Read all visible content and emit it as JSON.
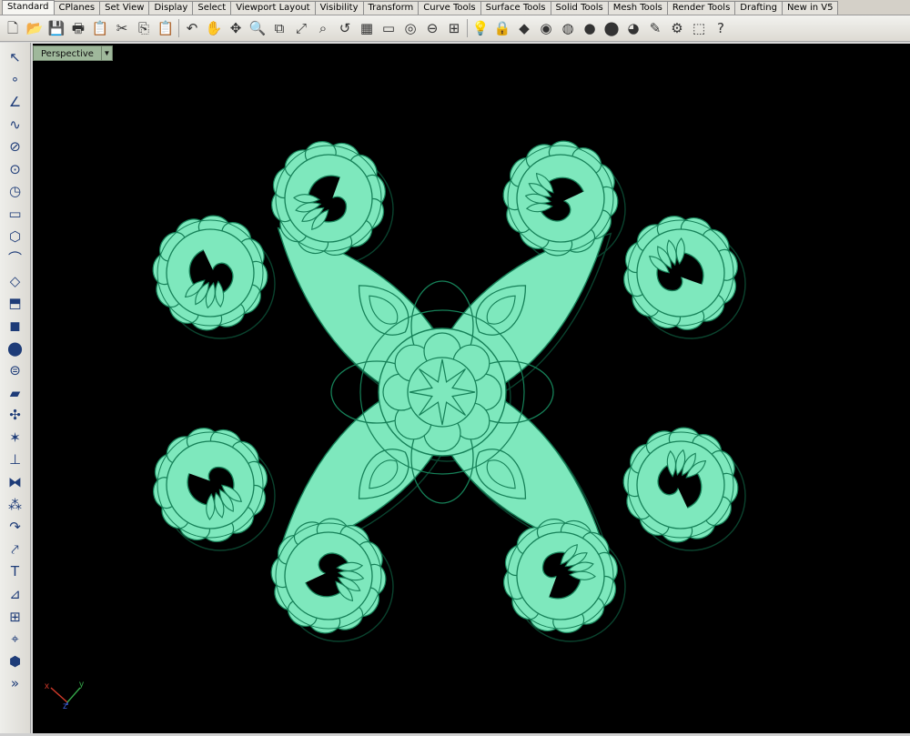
{
  "tabs": [
    {
      "label": "Standard",
      "active": true
    },
    {
      "label": "CPlanes"
    },
    {
      "label": "Set View"
    },
    {
      "label": "Display"
    },
    {
      "label": "Select"
    },
    {
      "label": "Viewport Layout"
    },
    {
      "label": "Visibility"
    },
    {
      "label": "Transform"
    },
    {
      "label": "Curve Tools"
    },
    {
      "label": "Surface Tools"
    },
    {
      "label": "Solid Tools"
    },
    {
      "label": "Mesh Tools"
    },
    {
      "label": "Render Tools"
    },
    {
      "label": "Drafting"
    },
    {
      "label": "New in V5"
    }
  ],
  "toolbar": [
    {
      "name": "new-icon",
      "glyph": "🗋"
    },
    {
      "name": "open-icon",
      "glyph": "📂"
    },
    {
      "name": "save-icon",
      "glyph": "💾"
    },
    {
      "name": "print-icon",
      "glyph": "🖶"
    },
    {
      "name": "import-icon",
      "glyph": "📋"
    },
    {
      "name": "cut-icon",
      "glyph": "✂"
    },
    {
      "name": "copy-icon",
      "glyph": "⎘"
    },
    {
      "name": "paste-icon",
      "glyph": "📋"
    },
    {
      "name": "undo-icon",
      "glyph": "↶"
    },
    {
      "name": "pan-hand-icon",
      "glyph": "✋"
    },
    {
      "name": "rotate-view-icon",
      "glyph": "✥"
    },
    {
      "name": "zoom-dynamic-icon",
      "glyph": "🔍"
    },
    {
      "name": "zoom-window-icon",
      "glyph": "⧉"
    },
    {
      "name": "zoom-extents-icon",
      "glyph": "⤢"
    },
    {
      "name": "zoom-selected-icon",
      "glyph": "⌕"
    },
    {
      "name": "undo-view-icon",
      "glyph": "↺"
    },
    {
      "name": "four-viewports-icon",
      "glyph": "▦"
    },
    {
      "name": "cplane-icon",
      "glyph": "▭"
    },
    {
      "name": "object-snap-icon",
      "glyph": "◎"
    },
    {
      "name": "select-filter-icon",
      "glyph": "⊖"
    },
    {
      "name": "grid-snap-icon",
      "glyph": "⊞"
    },
    {
      "name": "light-icon",
      "glyph": "💡"
    },
    {
      "name": "lock-icon",
      "glyph": "🔒"
    },
    {
      "name": "layer-icon",
      "glyph": "◆"
    },
    {
      "name": "color-wheel-icon",
      "glyph": "◉"
    },
    {
      "name": "wireframe-sphere-icon",
      "glyph": "◍"
    },
    {
      "name": "shaded-sphere-icon",
      "glyph": "●"
    },
    {
      "name": "render-sphere-icon",
      "glyph": "⬤"
    },
    {
      "name": "ghosted-sphere-icon",
      "glyph": "◕"
    },
    {
      "name": "pencil-options-icon",
      "glyph": "✎"
    },
    {
      "name": "gear-options-icon",
      "glyph": "⚙"
    },
    {
      "name": "selection-cursor-icon",
      "glyph": "⬚"
    },
    {
      "name": "help-icon",
      "glyph": "?"
    }
  ],
  "left_tools": [
    {
      "name": "select-arrow-icon",
      "glyph": "↖"
    },
    {
      "name": "point-icon",
      "glyph": "∘"
    },
    {
      "name": "polyline-icon",
      "glyph": "∠"
    },
    {
      "name": "curve-cv-icon",
      "glyph": "∿"
    },
    {
      "name": "circle-icon",
      "glyph": "⊘"
    },
    {
      "name": "ellipse-icon",
      "glyph": "⊙"
    },
    {
      "name": "arc-icon",
      "glyph": "◷"
    },
    {
      "name": "rectangle-icon",
      "glyph": "▭"
    },
    {
      "name": "polygon-icon",
      "glyph": "⬡"
    },
    {
      "name": "fillet-curve-icon",
      "glyph": "⌒"
    },
    {
      "name": "surface-corner-points-icon",
      "glyph": "◇"
    },
    {
      "name": "extrude-icon",
      "glyph": "⬒"
    },
    {
      "name": "box-solid-icon",
      "glyph": "◼"
    },
    {
      "name": "sphere-solid-icon",
      "glyph": "⬤"
    },
    {
      "name": "cylinder-icon",
      "glyph": "⊜"
    },
    {
      "name": "mesh-plane-icon",
      "glyph": "▰"
    },
    {
      "name": "boolean-union-icon",
      "glyph": "✣"
    },
    {
      "name": "explode-icon",
      "glyph": "✶"
    },
    {
      "name": "trim-icon",
      "glyph": "⊥"
    },
    {
      "name": "join-icon",
      "glyph": "⧓"
    },
    {
      "name": "group-icon",
      "glyph": "⁂"
    },
    {
      "name": "split-icon",
      "glyph": "↷"
    },
    {
      "name": "move-icon",
      "glyph": "⤤"
    },
    {
      "name": "text-icon",
      "glyph": "T"
    },
    {
      "name": "dimension-icon",
      "glyph": "⊿"
    },
    {
      "name": "array-icon",
      "glyph": "⊞"
    },
    {
      "name": "analyze-icon",
      "glyph": "⌖"
    },
    {
      "name": "render-cube-icon",
      "glyph": "⬢"
    },
    {
      "name": "more-tools-icon",
      "glyph": "»"
    }
  ],
  "viewport": {
    "title": "Perspective",
    "axis_x_label": "x",
    "axis_y_label": "y",
    "axis_z_label": "z"
  },
  "colors": {
    "ornament_fill": "#7ee8bd",
    "ornament_line": "#168058",
    "ornament_shadow": "#0c4a33",
    "viewport_bg": "#000000",
    "axis_x": "#d23a2a",
    "axis_y": "#35a84a",
    "axis_z": "#3b5fd8"
  }
}
